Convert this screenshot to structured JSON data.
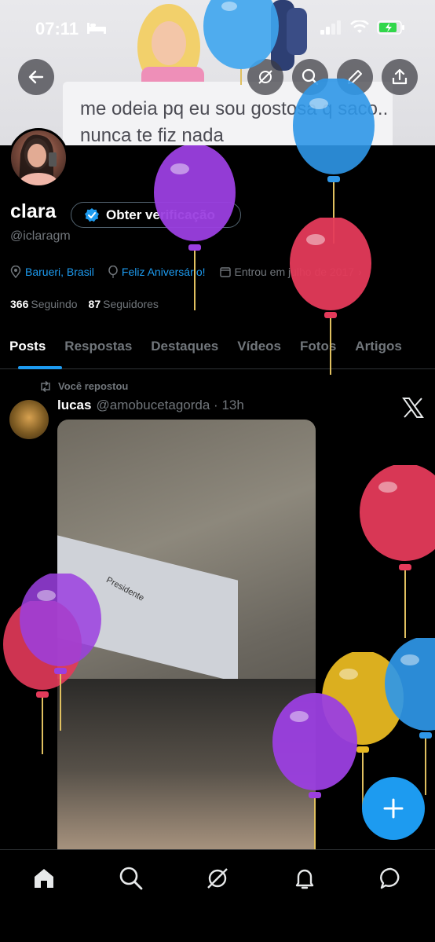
{
  "status_bar": {
    "time": "07:11"
  },
  "banner": {
    "text": "me odeia pq eu sou gostosa q saco.. nunca te fiz nada"
  },
  "profile": {
    "name": "clara",
    "handle": "@iclaragm",
    "verify_label": "Obter verificação",
    "location": "Barueri, Brasil",
    "birthday": "Feliz Aniversário!",
    "joined": "Entrou em julho de 2017",
    "following_count": "366",
    "following_label": "Seguindo",
    "followers_count": "87",
    "followers_label": "Seguidores"
  },
  "tabs": [
    "Posts",
    "Respostas",
    "Destaques",
    "Vídeos",
    "Fotos",
    "Artigos"
  ],
  "post": {
    "repost_label": "Você repostou",
    "author": "lucas",
    "handle_time": "@amobucetagorda · 13h",
    "media_label": "Presidente"
  },
  "colors": {
    "accent": "#1d9bf0",
    "background": "#000000",
    "muted": "#71767b"
  }
}
